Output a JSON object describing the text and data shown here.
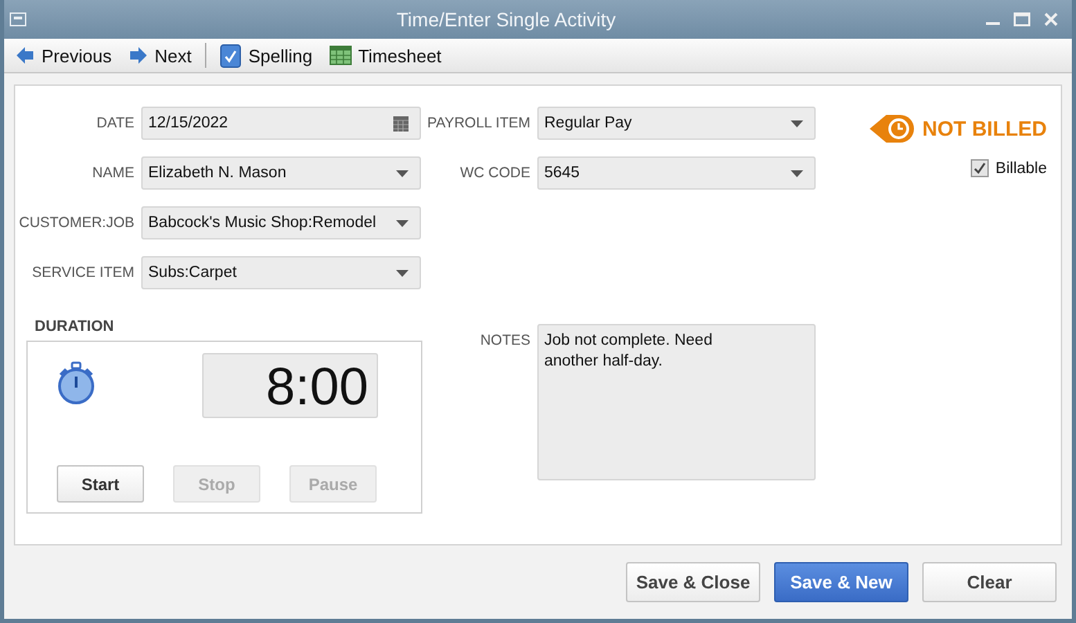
{
  "window": {
    "title": "Time/Enter Single Activity"
  },
  "toolbar": [
    {
      "kind": "prev",
      "label": "Previous"
    },
    {
      "kind": "next",
      "label": "Next"
    },
    {
      "kind": "spelling",
      "label": "Spelling"
    },
    {
      "kind": "timesheet",
      "label": "Timesheet"
    }
  ],
  "left_fields": [
    {
      "label": "DATE",
      "value": "12/15/2022",
      "kind": "date"
    },
    {
      "label": "NAME",
      "value": "Elizabeth N. Mason",
      "kind": "dropdown"
    },
    {
      "label": "CUSTOMER:JOB",
      "value": "Babcock's Music Shop:Remodel",
      "kind": "dropdown"
    },
    {
      "label": "SERVICE ITEM",
      "value": "Subs:Carpet",
      "kind": "dropdown"
    }
  ],
  "right_fields": [
    {
      "label": "PAYROLL ITEM",
      "value": "Regular Pay",
      "kind": "dropdown"
    },
    {
      "label": "WC CODE",
      "value": "5645",
      "kind": "dropdown"
    }
  ],
  "billing_status": "NOT BILLED",
  "billable": {
    "label": "Billable",
    "checked": true
  },
  "duration": {
    "label": "DURATION",
    "time": "8:00",
    "buttons": [
      {
        "label": "Start",
        "disabled": false
      },
      {
        "label": "Stop",
        "disabled": true
      },
      {
        "label": "Pause",
        "disabled": true
      }
    ]
  },
  "notes": {
    "label": "NOTES",
    "value": "Job not complete. Need another half-day."
  },
  "buttons": [
    {
      "label": "Save & Close",
      "kind": "normal"
    },
    {
      "label": "Save & New",
      "kind": "primary"
    },
    {
      "label": "Clear",
      "kind": "normal"
    }
  ]
}
